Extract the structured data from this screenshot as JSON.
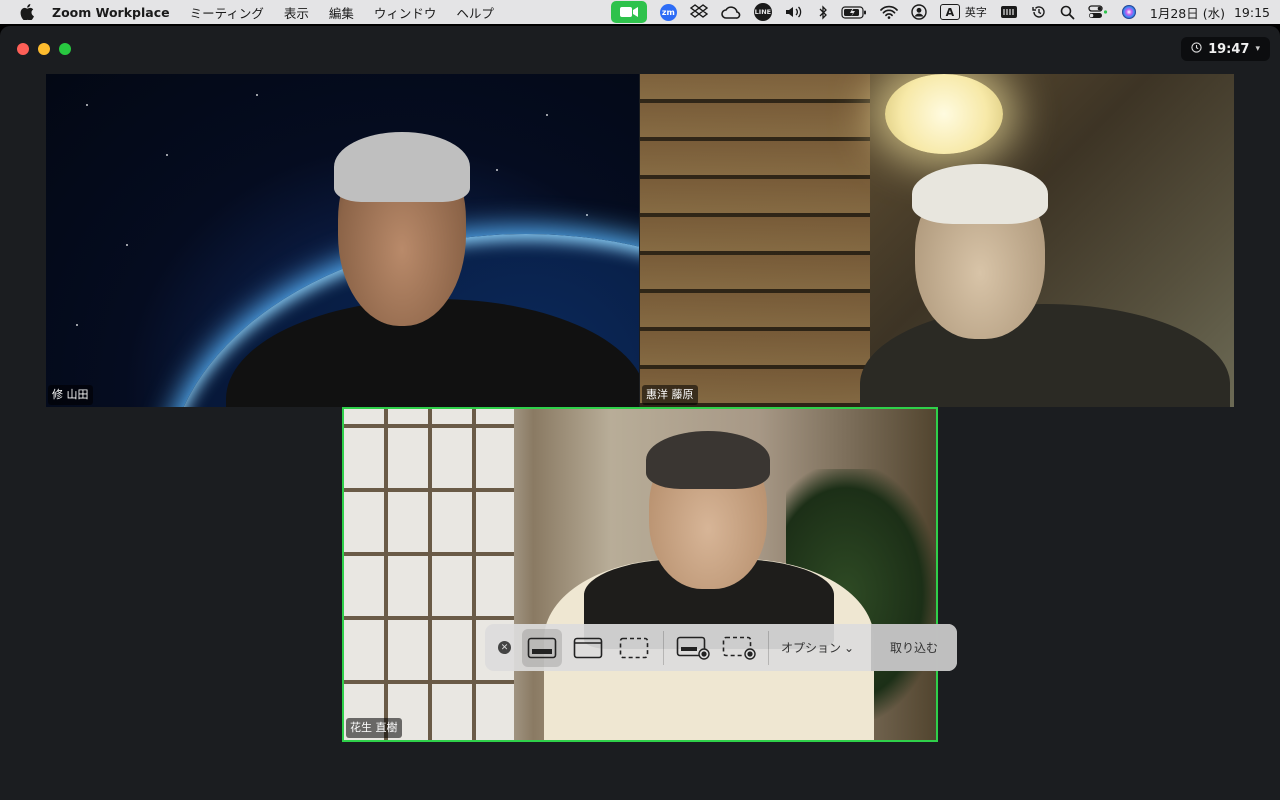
{
  "menubar": {
    "apple_icon": "apple-icon",
    "app_name": "Zoom Workplace",
    "menus": [
      "ミーティング",
      "表示",
      "編集",
      "ウィンドウ",
      "ヘルプ"
    ],
    "status": {
      "zoom_badge": "zm",
      "line_badge": "LINE",
      "ime_box": "A",
      "ime_label": "英字",
      "date": "1月28日 (水)",
      "time": "19:15"
    }
  },
  "window": {
    "timer": "19:47"
  },
  "participants": [
    {
      "name": "修 山田"
    },
    {
      "name": "惠洋 藤原"
    },
    {
      "name": "花生 直樹",
      "active_speaker": true
    }
  ],
  "capture_toolbar": {
    "options_label": "オプション",
    "capture_label": "取り込む",
    "selected_mode": "window"
  },
  "colors": {
    "active_speaker_border": "#2fd04a",
    "zoom_video_status": "#2ec24c",
    "window_bg": "#1b1d20"
  }
}
